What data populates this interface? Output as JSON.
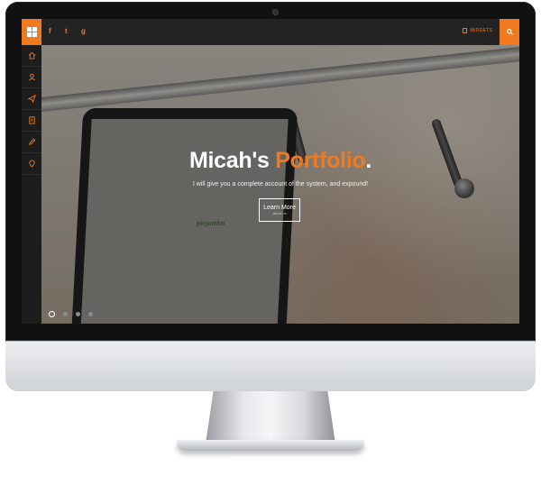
{
  "nav": {
    "social": [
      {
        "icon": "facebook-icon",
        "glyph": "f"
      },
      {
        "icon": "twitter-icon",
        "glyph": "t"
      },
      {
        "icon": "google-plus-icon",
        "glyph": "g"
      }
    ],
    "widgets_label": "WIDGETS"
  },
  "sidebar": {
    "items": [
      {
        "icon": "home-icon",
        "active": true
      },
      {
        "icon": "user-icon",
        "active": false
      },
      {
        "icon": "send-icon",
        "active": false
      },
      {
        "icon": "document-icon",
        "active": false
      },
      {
        "icon": "pencil-icon",
        "active": false
      },
      {
        "icon": "map-pin-icon",
        "active": false
      }
    ]
  },
  "hero": {
    "title_main": "Micah's ",
    "title_accent": "Portfolio",
    "title_dot": ".",
    "subtitle": "I will give you a complete account of the system, and expound!",
    "button_label": "Learn More",
    "button_sub": "ABOUT US",
    "laptop_text": "picjumbo"
  },
  "slider": {
    "count": 4,
    "active_index": 0
  },
  "colors": {
    "accent": "#f07a1f",
    "topbar": "#232323",
    "sidebar": "#1d1d1d"
  }
}
